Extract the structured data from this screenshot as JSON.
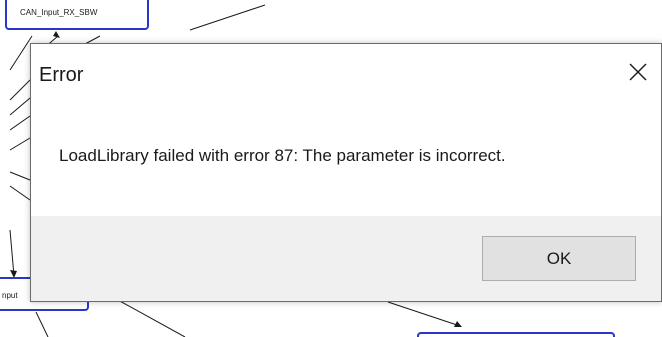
{
  "background": {
    "nodes": [
      {
        "id": "top-node",
        "label": "CAN_Input_RX_SBW"
      },
      {
        "id": "left-node",
        "label": "nput"
      }
    ]
  },
  "dialog": {
    "title": "Error",
    "message": "LoadLibrary failed with error 87: The parameter is incorrect.",
    "ok_label": "OK",
    "close_icon": "close-icon"
  },
  "colors": {
    "node_border": "#2a36c9",
    "dialog_footer": "#f0f0f0",
    "button_face": "#e1e1e1",
    "button_border": "#adadad"
  }
}
